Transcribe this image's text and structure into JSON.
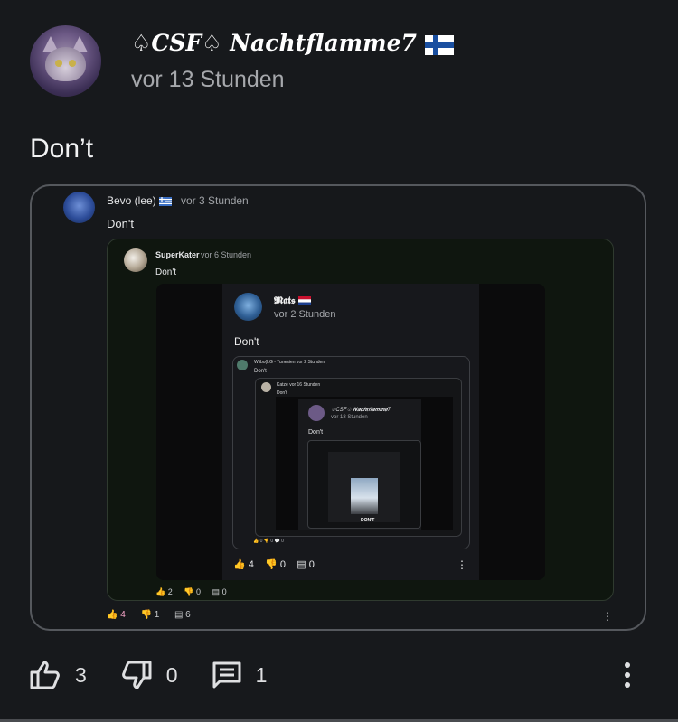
{
  "post": {
    "author": "♤CSF♤ 𝑵𝒂𝒄𝒉𝒕𝒇𝒍𝒂𝒎𝒎𝒆7",
    "timestamp": "vor 13 Stunden",
    "text": "Don’t",
    "likes": "3",
    "dislikes": "0",
    "comments": "1"
  },
  "embed1": {
    "author": "Bevo (lee)",
    "timestamp": "vor 3 Stunden",
    "text": "Don't",
    "likes": "4",
    "dislikes": "1",
    "comments": "6"
  },
  "embed2": {
    "author": "SuperKater",
    "timestamp": "vor 6 Stunden",
    "text": "Don't",
    "likes": "2",
    "dislikes": "0",
    "comments": "0"
  },
  "screenshot": {
    "author": "𝕸𝖆𝖙𝖘",
    "timestamp": "vor 2 Stunden",
    "text": "Don't",
    "likes": "4",
    "dislikes": "0",
    "comments": "0",
    "level3_author": "Wiibo(LG - Tunesien",
    "level3_time": "vor 2 Stunden",
    "level3_text": "Don't",
    "level3_actions": "👍 0   👎 0   💬 0",
    "level4_author": "Katze",
    "level4_time": "vor 16 Stunden",
    "level4_text": "Don't",
    "level5_author": "♤CSF♤ 𝑵𝒂𝒄𝒉𝒕𝒇𝒍𝒂𝒎𝒎𝒆7",
    "level5_time": "vor 18 Stunden",
    "level5_text": "Don't",
    "small_caption": "DON'T"
  },
  "colors": {
    "background": "#17191c",
    "liked_accent": "#f5a3c7"
  },
  "icons": [
    "thumbs-up-icon",
    "thumbs-down-icon",
    "comment-icon",
    "more-vert-icon",
    "finland-flag-icon",
    "greece-flag-icon",
    "netherlands-flag-icon"
  ]
}
